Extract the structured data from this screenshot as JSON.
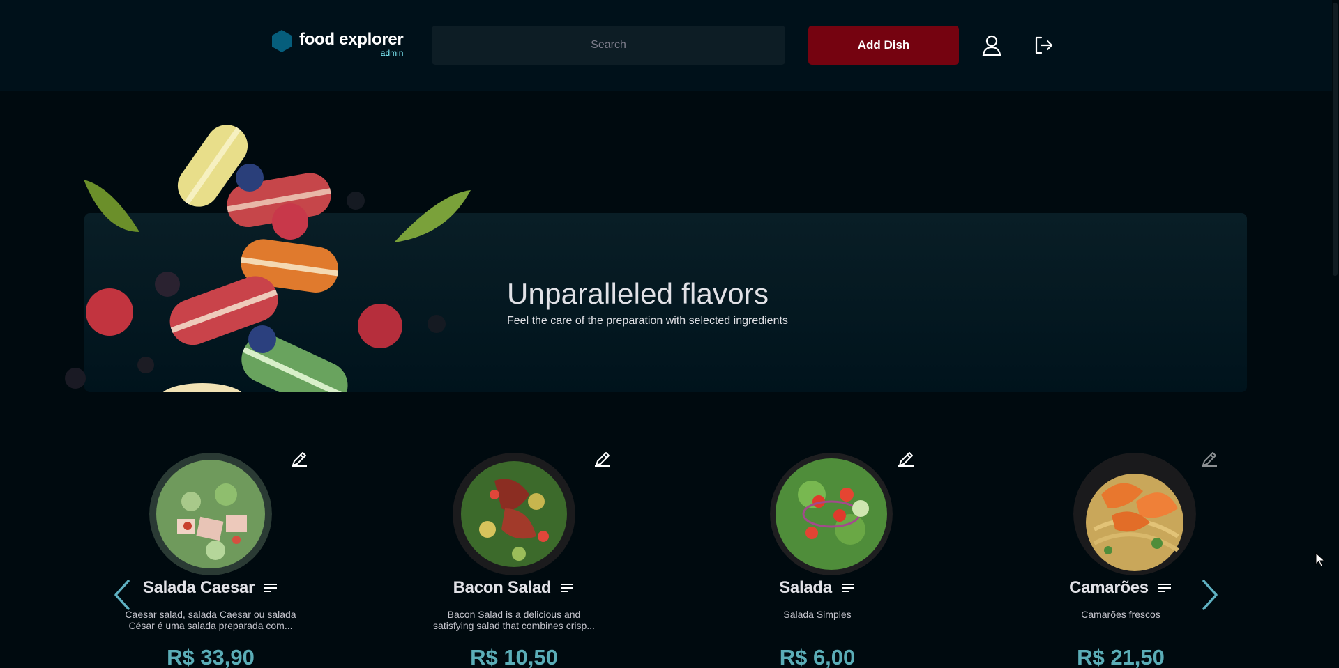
{
  "header": {
    "logo_title": "food explorer",
    "logo_sub": "admin",
    "search_placeholder": "Search",
    "add_dish_label": "Add Dish"
  },
  "banner": {
    "title": "Unparalleled flavors",
    "subtitle": "Feel the care of the preparation with selected ingredients"
  },
  "dishes": [
    {
      "name": "Salada Caesar",
      "description": "Caesar salad, salada Caesar ou salada César é uma salada preparada com...",
      "price": "R$ 33,90"
    },
    {
      "name": "Bacon Salad",
      "description": "Bacon Salad is a delicious and satisfying salad that combines crisp...",
      "price": "R$ 10,50"
    },
    {
      "name": "Salada",
      "description": "Salada Simples",
      "price": "R$ 6,00"
    },
    {
      "name": "Camarões",
      "description": "Camarões frescos",
      "price": "R$ 21,50"
    }
  ],
  "colors": {
    "header_bg": "#00111a",
    "page_bg": "#000a0f",
    "accent_red": "#750310",
    "accent_cyan": "#82f3ff",
    "logo_blue": "#065e7c"
  },
  "icons": {
    "logo": "hexagon-icon",
    "profile": "user-icon",
    "logout": "sign-out-icon",
    "edit": "pencil-icon",
    "menu": "lines-icon",
    "prev": "chevron-left-icon",
    "next": "chevron-right-icon"
  }
}
